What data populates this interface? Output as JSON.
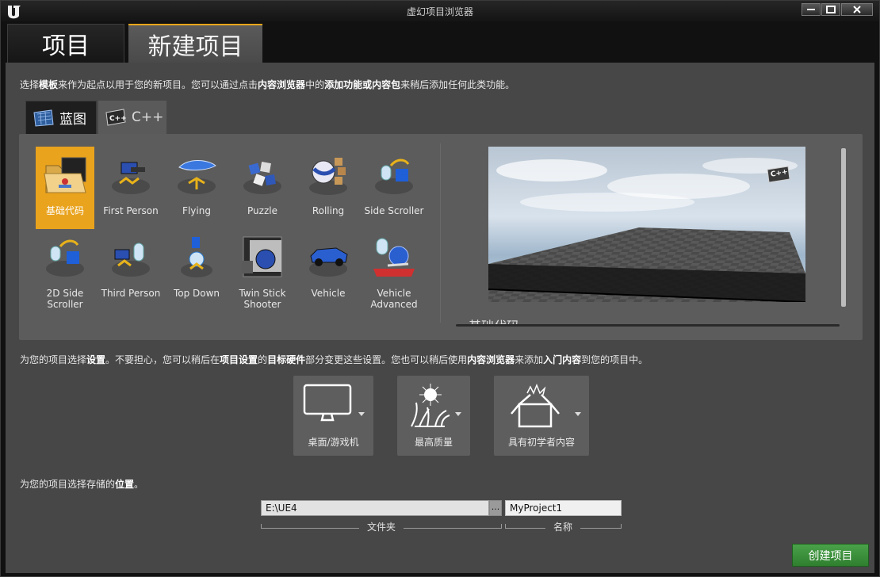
{
  "window": {
    "title": "虚幻项目浏览器"
  },
  "main_tabs": [
    {
      "label": "项目",
      "selected": false
    },
    {
      "label": "新建项目",
      "selected": true
    }
  ],
  "intro": {
    "p1": "选择",
    "b1": "模板",
    "p2": "来作为起点以用于您的新项目。您可以通过点击",
    "b2": "内容浏览器",
    "p3": "中的",
    "b3": "添加功能或内容包",
    "p4": "来稍后添加任何此类功能。"
  },
  "sub_tabs": [
    {
      "label": "蓝图",
      "icon": "blueprint-icon",
      "selected": true
    },
    {
      "label": "C++",
      "icon": "cpp-icon",
      "selected": false
    }
  ],
  "templates": [
    {
      "label": "基础代码",
      "icon": "folder-icon",
      "selected": true
    },
    {
      "label": "First Person",
      "icon": "first-person-icon"
    },
    {
      "label": "Flying",
      "icon": "flying-icon"
    },
    {
      "label": "Puzzle",
      "icon": "puzzle-icon"
    },
    {
      "label": "Rolling",
      "icon": "rolling-icon"
    },
    {
      "label": "Side Scroller",
      "icon": "side-scroller-icon"
    },
    {
      "label": "2D Side Scroller",
      "icon": "2d-side-scroller-icon"
    },
    {
      "label": "Third Person",
      "icon": "third-person-icon"
    },
    {
      "label": "Top Down",
      "icon": "top-down-icon"
    },
    {
      "label": "Twin Stick Shooter",
      "icon": "twin-stick-shooter-icon"
    },
    {
      "label": "Vehicle",
      "icon": "vehicle-icon"
    },
    {
      "label": "Vehicle Advanced",
      "icon": "vehicle-advanced-icon"
    }
  ],
  "preview": {
    "badge": "C++",
    "caption": "基础代码"
  },
  "settings_intro": {
    "p1": "为您的项目选择",
    "b1": "设置",
    "p2": "。不要担心，您可以稍后在",
    "b2": "项目设置",
    "p3": "的",
    "b3": "目标硬件",
    "p4": "部分变更这些设置。您也可以稍后使用",
    "b4": "内容浏览器",
    "p5": "来添加",
    "b5": "入门内容",
    "p6": "到您的项目中。"
  },
  "settings": [
    {
      "label": "桌面/游戏机",
      "icon": "monitor-icon"
    },
    {
      "label": "最高质量",
      "icon": "max-quality-icon"
    },
    {
      "label": "具有初学者内容",
      "icon": "starter-content-icon"
    }
  ],
  "location_intro": {
    "p1": "为您的项目选择存储的",
    "b1": "位置",
    "p2": "。"
  },
  "location": {
    "folder_value": "E:\\UE4",
    "browse_label": "...",
    "name_value": "MyProject1",
    "folder_caption": "文件夹",
    "name_caption": "名称"
  },
  "create_button": "创建项目",
  "colors": {
    "accent": "#e9a31d",
    "create_green": "#3f913f",
    "panel": "#474747"
  }
}
